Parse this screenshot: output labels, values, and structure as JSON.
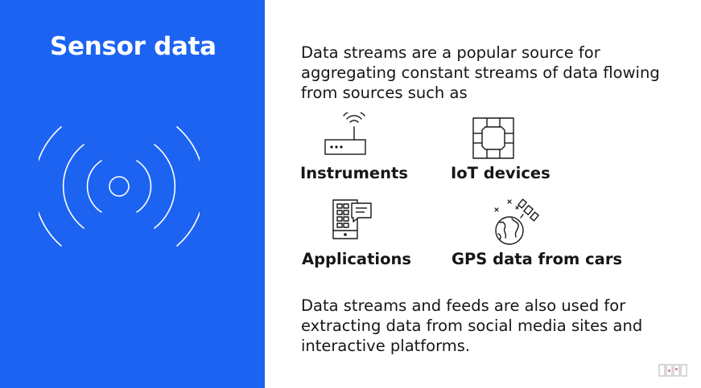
{
  "slide": {
    "title": "Sensor data",
    "intro": "Data streams are a popular source for aggregating constant streams of data flowing from sources such as",
    "outro": "Data streams and feeds are also used for extracting data from social media sites and interactive platforms."
  },
  "sources": [
    {
      "label": "Instruments",
      "icon": "router-icon"
    },
    {
      "label": "IoT devices",
      "icon": "chip-icon"
    },
    {
      "label": "Applications",
      "icon": "mobile-app-icon"
    },
    {
      "label": "GPS data from cars",
      "icon": "globe-satellite-icon"
    }
  ],
  "colors": {
    "accent": "#1c63f2",
    "text": "#161616",
    "background": "#ffffff"
  }
}
